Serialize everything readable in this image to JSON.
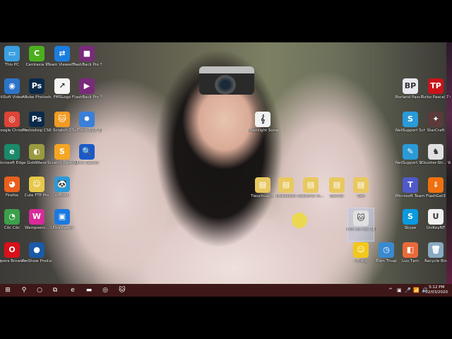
{
  "desktop": {
    "icons": [
      {
        "label": "This PC",
        "color": "#3aa0e0",
        "glyph": "▭"
      },
      {
        "label": "Camtasia 9",
        "color": "#4caf1e",
        "glyph": "C"
      },
      {
        "label": "Team Viewer Portable",
        "color": "#1a7ee0",
        "glyph": "⇄"
      },
      {
        "label": "FlashBack Pro 5 Re...",
        "color": "#7a2a7a",
        "glyph": "■"
      },
      {
        "label": "GiliSoft Video Editor 11.3.0",
        "color": "#2b74c8",
        "glyph": "◉"
      },
      {
        "label": "Adobe Photosh...",
        "color": "#0b2a4a",
        "glyph": "Ps"
      },
      {
        "label": "FMSLogo",
        "color": "#f4f4f4",
        "glyph": "↗"
      },
      {
        "label": "FlashBack Pro 5 Player",
        "color": "#7a2a7a",
        "glyph": "▶"
      },
      {
        "label": "Google Chrome",
        "color": "#db4437",
        "glyph": "◎"
      },
      {
        "label": "Photoshop CS6",
        "color": "#0b2a4a",
        "glyph": "Ps"
      },
      {
        "label": "Scratch 2",
        "color": "#f29b22",
        "glyph": "🐱"
      },
      {
        "label": "SoThink SWF Decompiler",
        "color": "#3a7fd8",
        "glyph": "✹"
      },
      {
        "label": "Microsoft Edge Dev",
        "color": "#1a8a6a",
        "glyph": "e"
      },
      {
        "label": "GoldWave",
        "color": "#9a9a40",
        "glyph": "◐"
      },
      {
        "label": "Scratch Desktop",
        "color": "#f5a623",
        "glyph": "S"
      },
      {
        "label": "Ultra Search",
        "color": "#1a5ac8",
        "glyph": "🔍"
      },
      {
        "label": "Firefox",
        "color": "#e8601c",
        "glyph": "◕"
      },
      {
        "label": "Cute FTP Pro",
        "color": "#e6c84a",
        "glyph": "☺"
      },
      {
        "label": "mBlock",
        "color": "#2a9ad8",
        "glyph": "🐼"
      },
      {
        "label": "Cốc Cốc",
        "color": "#3aa04a",
        "glyph": "◔"
      },
      {
        "label": "Wampserv...",
        "color": "#d82a9a",
        "glyph": "W"
      },
      {
        "label": "UltraViewer",
        "color": "#1a7ae0",
        "glyph": "▣"
      },
      {
        "label": "Opera Browser",
        "color": "#d8101a",
        "glyph": "O"
      },
      {
        "label": "ProShow Producer",
        "color": "#1a5aa8",
        "glyph": "●"
      },
      {
        "label": "Moonlight Sonata - B...",
        "color": "#f0f0f0",
        "glyph": "𝄞"
      },
      {
        "label": "Tieuchuan...",
        "color": "#e8c860",
        "glyph": "▤"
      },
      {
        "label": "Nhadatlan",
        "color": "#e8c860",
        "glyph": "▤"
      },
      {
        "label": "Datcome m...",
        "color": "#e8c860",
        "glyph": "▤"
      },
      {
        "label": "Banner",
        "color": "#e8c860",
        "glyph": "▤"
      },
      {
        "label": "Tam",
        "color": "#e8c860",
        "glyph": "▤"
      },
      {
        "label": "Vinh du hoc SCRATCH.sb2",
        "color": "#e0e0e0",
        "glyph": "🐱"
      },
      {
        "label": "Ì Dừng",
        "color": "#f2c81a",
        "glyph": "☺"
      },
      {
        "label": "Borland Pascal 7.0",
        "color": "#e8e8f0",
        "glyph": "BP"
      },
      {
        "label": "Turbo Pascal 7.0",
        "color": "#c8141a",
        "glyph": "TP"
      },
      {
        "label": "NetSupport School Tut...",
        "color": "#2a9ad8",
        "glyph": "S"
      },
      {
        "label": "StarCraft",
        "color": "#5a3a3a",
        "glyph": "✦"
      },
      {
        "label": "NetSupport School Te...",
        "color": "#2a9ad8",
        "glyph": "✎"
      },
      {
        "label": "Counter-Str... WaRzOnE",
        "color": "#e0e0e0",
        "glyph": "♞"
      },
      {
        "label": "Microsoft Teams",
        "color": "#5059c9",
        "glyph": "T"
      },
      {
        "label": "FlashGet3",
        "color": "#f07010",
        "glyph": "⇓"
      },
      {
        "label": "Skype",
        "color": "#0a9ae0",
        "glyph": "S"
      },
      {
        "label": "UniKeyNT",
        "color": "#f0f0f0",
        "glyph": "U"
      },
      {
        "label": "Điện Thoại",
        "color": "#3a8ad0",
        "glyph": "◷"
      },
      {
        "label": "Lưu Tạm",
        "color": "#e86a3a",
        "glyph": "◧"
      },
      {
        "label": "Recycle Bin",
        "color": "#8aa8c0",
        "glyph": "🗑"
      }
    ]
  },
  "taskbar": {
    "buttons": [
      {
        "name": "start",
        "glyph": "⊞"
      },
      {
        "name": "search",
        "glyph": "⚲"
      },
      {
        "name": "cortana",
        "glyph": "○"
      },
      {
        "name": "task-view",
        "glyph": "⧉"
      },
      {
        "name": "edge-dev",
        "glyph": "e"
      },
      {
        "name": "file-explorer",
        "glyph": "▬"
      },
      {
        "name": "chrome",
        "glyph": "◎"
      },
      {
        "name": "scratch",
        "glyph": "🐱"
      }
    ],
    "tray": [
      "^",
      "▣",
      "🎤",
      "📶",
      "🔊"
    ],
    "time": "5:12 PM",
    "date": "02/03/2020"
  }
}
